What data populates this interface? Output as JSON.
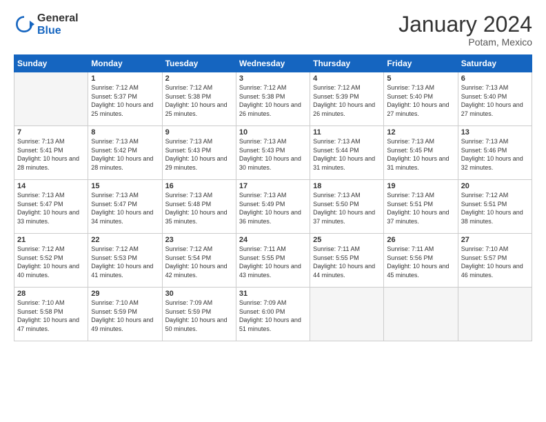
{
  "logo": {
    "general": "General",
    "blue": "Blue"
  },
  "title": "January 2024",
  "location": "Potam, Mexico",
  "days_header": [
    "Sunday",
    "Monday",
    "Tuesday",
    "Wednesday",
    "Thursday",
    "Friday",
    "Saturday"
  ],
  "weeks": [
    [
      {
        "day": "",
        "sunrise": "",
        "sunset": "",
        "daylight": ""
      },
      {
        "day": "1",
        "sunrise": "Sunrise: 7:12 AM",
        "sunset": "Sunset: 5:37 PM",
        "daylight": "Daylight: 10 hours and 25 minutes."
      },
      {
        "day": "2",
        "sunrise": "Sunrise: 7:12 AM",
        "sunset": "Sunset: 5:38 PM",
        "daylight": "Daylight: 10 hours and 25 minutes."
      },
      {
        "day": "3",
        "sunrise": "Sunrise: 7:12 AM",
        "sunset": "Sunset: 5:38 PM",
        "daylight": "Daylight: 10 hours and 26 minutes."
      },
      {
        "day": "4",
        "sunrise": "Sunrise: 7:12 AM",
        "sunset": "Sunset: 5:39 PM",
        "daylight": "Daylight: 10 hours and 26 minutes."
      },
      {
        "day": "5",
        "sunrise": "Sunrise: 7:13 AM",
        "sunset": "Sunset: 5:40 PM",
        "daylight": "Daylight: 10 hours and 27 minutes."
      },
      {
        "day": "6",
        "sunrise": "Sunrise: 7:13 AM",
        "sunset": "Sunset: 5:40 PM",
        "daylight": "Daylight: 10 hours and 27 minutes."
      }
    ],
    [
      {
        "day": "7",
        "sunrise": "Sunrise: 7:13 AM",
        "sunset": "Sunset: 5:41 PM",
        "daylight": "Daylight: 10 hours and 28 minutes."
      },
      {
        "day": "8",
        "sunrise": "Sunrise: 7:13 AM",
        "sunset": "Sunset: 5:42 PM",
        "daylight": "Daylight: 10 hours and 28 minutes."
      },
      {
        "day": "9",
        "sunrise": "Sunrise: 7:13 AM",
        "sunset": "Sunset: 5:43 PM",
        "daylight": "Daylight: 10 hours and 29 minutes."
      },
      {
        "day": "10",
        "sunrise": "Sunrise: 7:13 AM",
        "sunset": "Sunset: 5:43 PM",
        "daylight": "Daylight: 10 hours and 30 minutes."
      },
      {
        "day": "11",
        "sunrise": "Sunrise: 7:13 AM",
        "sunset": "Sunset: 5:44 PM",
        "daylight": "Daylight: 10 hours and 31 minutes."
      },
      {
        "day": "12",
        "sunrise": "Sunrise: 7:13 AM",
        "sunset": "Sunset: 5:45 PM",
        "daylight": "Daylight: 10 hours and 31 minutes."
      },
      {
        "day": "13",
        "sunrise": "Sunrise: 7:13 AM",
        "sunset": "Sunset: 5:46 PM",
        "daylight": "Daylight: 10 hours and 32 minutes."
      }
    ],
    [
      {
        "day": "14",
        "sunrise": "Sunrise: 7:13 AM",
        "sunset": "Sunset: 5:47 PM",
        "daylight": "Daylight: 10 hours and 33 minutes."
      },
      {
        "day": "15",
        "sunrise": "Sunrise: 7:13 AM",
        "sunset": "Sunset: 5:47 PM",
        "daylight": "Daylight: 10 hours and 34 minutes."
      },
      {
        "day": "16",
        "sunrise": "Sunrise: 7:13 AM",
        "sunset": "Sunset: 5:48 PM",
        "daylight": "Daylight: 10 hours and 35 minutes."
      },
      {
        "day": "17",
        "sunrise": "Sunrise: 7:13 AM",
        "sunset": "Sunset: 5:49 PM",
        "daylight": "Daylight: 10 hours and 36 minutes."
      },
      {
        "day": "18",
        "sunrise": "Sunrise: 7:13 AM",
        "sunset": "Sunset: 5:50 PM",
        "daylight": "Daylight: 10 hours and 37 minutes."
      },
      {
        "day": "19",
        "sunrise": "Sunrise: 7:13 AM",
        "sunset": "Sunset: 5:51 PM",
        "daylight": "Daylight: 10 hours and 37 minutes."
      },
      {
        "day": "20",
        "sunrise": "Sunrise: 7:12 AM",
        "sunset": "Sunset: 5:51 PM",
        "daylight": "Daylight: 10 hours and 38 minutes."
      }
    ],
    [
      {
        "day": "21",
        "sunrise": "Sunrise: 7:12 AM",
        "sunset": "Sunset: 5:52 PM",
        "daylight": "Daylight: 10 hours and 40 minutes."
      },
      {
        "day": "22",
        "sunrise": "Sunrise: 7:12 AM",
        "sunset": "Sunset: 5:53 PM",
        "daylight": "Daylight: 10 hours and 41 minutes."
      },
      {
        "day": "23",
        "sunrise": "Sunrise: 7:12 AM",
        "sunset": "Sunset: 5:54 PM",
        "daylight": "Daylight: 10 hours and 42 minutes."
      },
      {
        "day": "24",
        "sunrise": "Sunrise: 7:11 AM",
        "sunset": "Sunset: 5:55 PM",
        "daylight": "Daylight: 10 hours and 43 minutes."
      },
      {
        "day": "25",
        "sunrise": "Sunrise: 7:11 AM",
        "sunset": "Sunset: 5:55 PM",
        "daylight": "Daylight: 10 hours and 44 minutes."
      },
      {
        "day": "26",
        "sunrise": "Sunrise: 7:11 AM",
        "sunset": "Sunset: 5:56 PM",
        "daylight": "Daylight: 10 hours and 45 minutes."
      },
      {
        "day": "27",
        "sunrise": "Sunrise: 7:10 AM",
        "sunset": "Sunset: 5:57 PM",
        "daylight": "Daylight: 10 hours and 46 minutes."
      }
    ],
    [
      {
        "day": "28",
        "sunrise": "Sunrise: 7:10 AM",
        "sunset": "Sunset: 5:58 PM",
        "daylight": "Daylight: 10 hours and 47 minutes."
      },
      {
        "day": "29",
        "sunrise": "Sunrise: 7:10 AM",
        "sunset": "Sunset: 5:59 PM",
        "daylight": "Daylight: 10 hours and 49 minutes."
      },
      {
        "day": "30",
        "sunrise": "Sunrise: 7:09 AM",
        "sunset": "Sunset: 5:59 PM",
        "daylight": "Daylight: 10 hours and 50 minutes."
      },
      {
        "day": "31",
        "sunrise": "Sunrise: 7:09 AM",
        "sunset": "Sunset: 6:00 PM",
        "daylight": "Daylight: 10 hours and 51 minutes."
      },
      {
        "day": "",
        "sunrise": "",
        "sunset": "",
        "daylight": ""
      },
      {
        "day": "",
        "sunrise": "",
        "sunset": "",
        "daylight": ""
      },
      {
        "day": "",
        "sunrise": "",
        "sunset": "",
        "daylight": ""
      }
    ]
  ]
}
